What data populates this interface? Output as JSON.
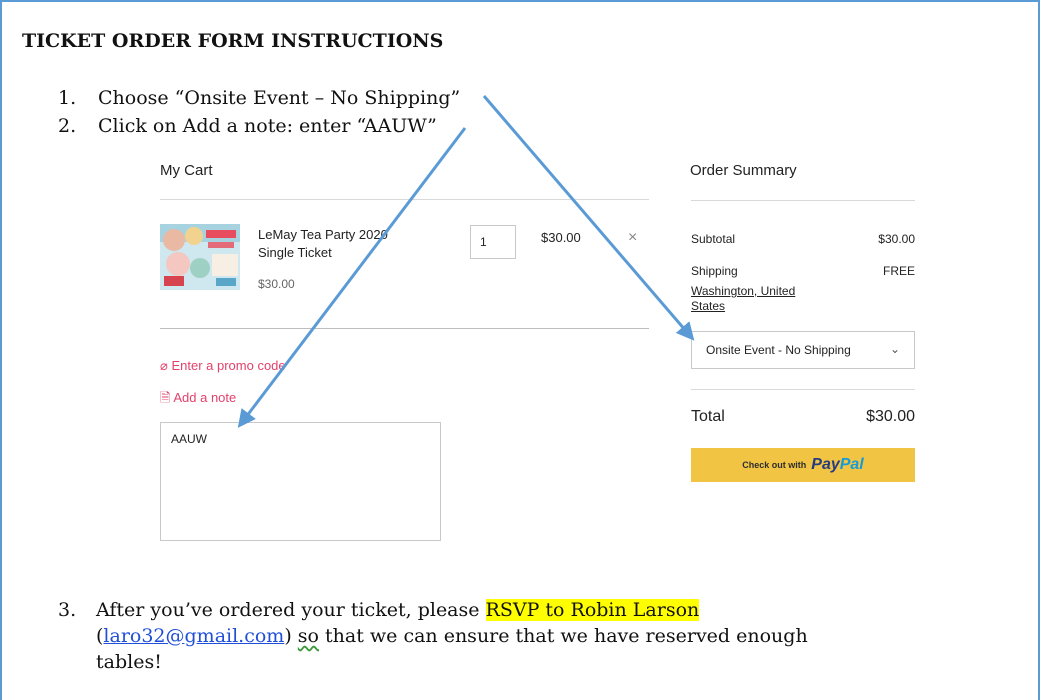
{
  "document": {
    "title": "TICKET ORDER FORM INSTRUCTIONS",
    "steps": [
      {
        "number": "1.",
        "text": "Choose “Onsite Event – No Shipping”"
      },
      {
        "number": "2.",
        "text": "Click on Add a note: enter “AAUW”"
      }
    ],
    "step3": {
      "number": "3.",
      "text_before": "After you’ve ordered your ticket, please ",
      "highlight": "RSVP to Robin Larson",
      "open_paren": "(",
      "email": "laro32@gmail.com",
      "close_paren": ")",
      "so": "so",
      "text_after": " that we can ensure that we have reserved enough",
      "last_line": "tables!"
    }
  },
  "cart": {
    "title": "My Cart",
    "item": {
      "name": "LeMay Tea Party 2020 Single Ticket",
      "unit_price": "$30.00",
      "quantity": "1",
      "price": "$30.00",
      "remove_icon": "close-icon"
    },
    "promo_label": "Enter a promo code",
    "note_label": "Add a note",
    "note_value": "AAUW"
  },
  "summary": {
    "title": "Order Summary",
    "subtotal_label": "Subtotal",
    "subtotal_value": "$30.00",
    "shipping_label": "Shipping",
    "shipping_value": "FREE",
    "shipping_location": "Washington, United States",
    "shipping_option": "Onsite Event - No Shipping",
    "total_label": "Total",
    "total_value": "$30.00",
    "paypal_prefix": "Check out with",
    "paypal_pay": "Pay",
    "paypal_pal": "Pal"
  },
  "colors": {
    "accent_link": "#e2416b",
    "paypal_button": "#f2c443",
    "arrow": "#5b9bd5",
    "highlight": "#ffff00"
  }
}
